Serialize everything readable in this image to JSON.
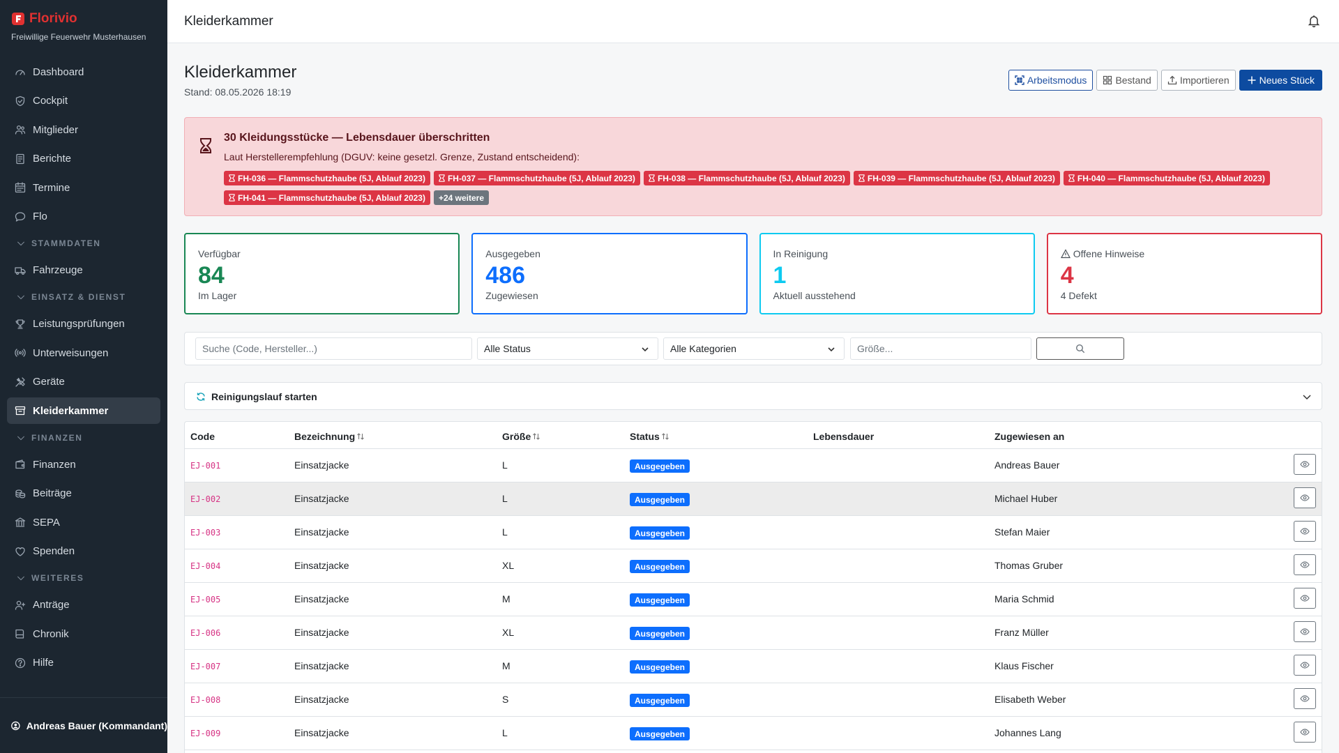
{
  "brand": {
    "name": "Florivio",
    "org": "Freiwillige Feuerwehr Musterhausen",
    "color": "#e03131"
  },
  "sidebar": {
    "items": [
      {
        "type": "item",
        "label": "Dashboard",
        "icon": "gauge-icon"
      },
      {
        "type": "item",
        "label": "Cockpit",
        "icon": "shield-icon"
      },
      {
        "type": "item",
        "label": "Mitglieder",
        "icon": "people-icon"
      },
      {
        "type": "item",
        "label": "Berichte",
        "icon": "document-icon"
      },
      {
        "type": "item",
        "label": "Termine",
        "icon": "calendar-icon"
      },
      {
        "type": "item",
        "label": "Flo",
        "icon": "chat-icon"
      },
      {
        "type": "section",
        "label": "STAMMDATEN",
        "icon": "chevron-down-icon"
      },
      {
        "type": "item",
        "label": "Fahrzeuge",
        "icon": "truck-icon"
      },
      {
        "type": "section",
        "label": "EINSATZ & DIENST",
        "icon": "chevron-down-icon"
      },
      {
        "type": "item",
        "label": "Leistungsprüfungen",
        "icon": "trophy-icon"
      },
      {
        "type": "item",
        "label": "Unterweisungen",
        "icon": "broadcast-icon"
      },
      {
        "type": "item",
        "label": "Geräte",
        "icon": "tools-icon"
      },
      {
        "type": "item",
        "label": "Kleiderkammer",
        "icon": "archive-icon",
        "active": true
      },
      {
        "type": "section",
        "label": "FINANZEN",
        "icon": "chevron-down-icon"
      },
      {
        "type": "item",
        "label": "Finanzen",
        "icon": "wallet-icon"
      },
      {
        "type": "item",
        "label": "Beiträge",
        "icon": "coins-icon"
      },
      {
        "type": "item",
        "label": "SEPA",
        "icon": "bank-icon"
      },
      {
        "type": "item",
        "label": "Spenden",
        "icon": "heart-icon"
      },
      {
        "type": "section",
        "label": "WEITERES",
        "icon": "chevron-down-icon"
      },
      {
        "type": "item",
        "label": "Anträge",
        "icon": "person-plus-icon"
      },
      {
        "type": "item",
        "label": "Chronik",
        "icon": "book-icon"
      },
      {
        "type": "item",
        "label": "Hilfe",
        "icon": "question-icon"
      }
    ],
    "user": "Andreas Bauer (Kommandant)"
  },
  "topbar": {
    "title": "Kleiderkammer"
  },
  "page": {
    "title": "Kleiderkammer",
    "subtitle": "Stand: 08.05.2026 18:19",
    "actions": {
      "workmode": "Arbeitsmodus",
      "stock": "Bestand",
      "import": "Importieren",
      "new": "Neues Stück"
    }
  },
  "alert": {
    "title": "30 Kleidungsstücke — Lebensdauer überschritten",
    "text": "Laut Herstellerempfehlung (DGUV: keine gesetzl. Grenze, Zustand entscheidend):",
    "tags": [
      "FH-036 — Flammschutzhaube (5J, Ablauf 2023)",
      "FH-037 — Flammschutzhaube (5J, Ablauf 2023)",
      "FH-038 — Flammschutzhaube (5J, Ablauf 2023)",
      "FH-039 — Flammschutzhaube (5J, Ablauf 2023)",
      "FH-040 — Flammschutzhaube (5J, Ablauf 2023)",
      "FH-041 — Flammschutzhaube (5J, Ablauf 2023)"
    ],
    "more": "+24 weitere"
  },
  "stats": [
    {
      "label": "Verfügbar",
      "value": "84",
      "sub": "Im Lager",
      "color": "#198754"
    },
    {
      "label": "Ausgegeben",
      "value": "486",
      "sub": "Zugewiesen",
      "color": "#0d6efd"
    },
    {
      "label": "In Reinigung",
      "value": "1",
      "sub": "Aktuell ausstehend",
      "color": "#0dcaf0"
    },
    {
      "label": "Offene Hinweise",
      "value": "4",
      "sub": "4 Defekt",
      "color": "#dc3545"
    }
  ],
  "filters": {
    "search_placeholder": "Suche (Code, Hersteller...)",
    "status": "Alle Status",
    "category": "Alle Kategorien",
    "size_placeholder": "Größe..."
  },
  "cleaning": {
    "label": "Reinigungslauf starten"
  },
  "table": {
    "headers": {
      "code": "Code",
      "name": "Bezeichnung",
      "size": "Größe",
      "status": "Status",
      "life": "Lebensdauer",
      "assigned": "Zugewiesen an"
    },
    "rows": [
      {
        "code": "EJ-001",
        "name": "Einsatzjacke",
        "size": "L",
        "status": "Ausgegeben",
        "life": "",
        "assigned": "Andreas Bauer"
      },
      {
        "code": "EJ-002",
        "name": "Einsatzjacke",
        "size": "L",
        "status": "Ausgegeben",
        "life": "",
        "assigned": "Michael Huber"
      },
      {
        "code": "EJ-003",
        "name": "Einsatzjacke",
        "size": "L",
        "status": "Ausgegeben",
        "life": "",
        "assigned": "Stefan Maier"
      },
      {
        "code": "EJ-004",
        "name": "Einsatzjacke",
        "size": "XL",
        "status": "Ausgegeben",
        "life": "",
        "assigned": "Thomas Gruber"
      },
      {
        "code": "EJ-005",
        "name": "Einsatzjacke",
        "size": "M",
        "status": "Ausgegeben",
        "life": "",
        "assigned": "Maria Schmid"
      },
      {
        "code": "EJ-006",
        "name": "Einsatzjacke",
        "size": "XL",
        "status": "Ausgegeben",
        "life": "",
        "assigned": "Franz Müller"
      },
      {
        "code": "EJ-007",
        "name": "Einsatzjacke",
        "size": "M",
        "status": "Ausgegeben",
        "life": "",
        "assigned": "Klaus Fischer"
      },
      {
        "code": "EJ-008",
        "name": "Einsatzjacke",
        "size": "S",
        "status": "Ausgegeben",
        "life": "",
        "assigned": "Elisabeth Weber"
      },
      {
        "code": "EJ-009",
        "name": "Einsatzjacke",
        "size": "L",
        "status": "Ausgegeben",
        "life": "",
        "assigned": "Johannes Lang"
      }
    ]
  }
}
